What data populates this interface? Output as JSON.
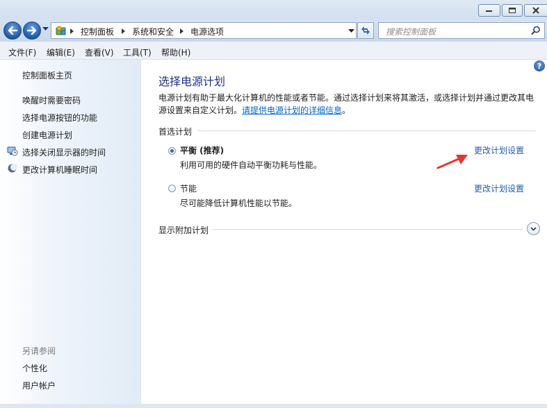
{
  "window": {
    "controls": {
      "minimize_icon": "minimize-icon",
      "maximize_icon": "maximize-icon",
      "close_icon": "close-icon"
    }
  },
  "address_bar": {
    "breadcrumbs": [
      "控制面板",
      "系统和安全",
      "电源选项"
    ]
  },
  "search": {
    "placeholder": "搜索控制面板"
  },
  "menu": {
    "items": [
      "文件(F)",
      "编辑(E)",
      "查看(V)",
      "工具(T)",
      "帮助(H)"
    ]
  },
  "sidebar": {
    "home": "控制面板主页",
    "links": [
      "唤醒时需要密码",
      "选择电源按钮的功能",
      "创建电源计划",
      "选择关闭显示器的时间",
      "更改计算机睡眠时间"
    ],
    "see_also_title": "另请参阅",
    "see_also": [
      "个性化",
      "用户帐户"
    ]
  },
  "main": {
    "title": "选择电源计划",
    "description": "电源计划有助于最大化计算机的性能或者节能。通过选择计划来将其激活，或选择计划并通过更改其电源设置来自定义计划。",
    "description_link": "请提供电源计划的详细信息",
    "preferred_plans_label": "首选计划",
    "plans": [
      {
        "name": "平衡 (推荐)",
        "description": "利用可用的硬件自动平衡功耗与性能。",
        "link": "更改计划设置",
        "selected": true
      },
      {
        "name": "节能",
        "description": "尽可能降低计算机性能以节能。",
        "link": "更改计划设置",
        "selected": false
      }
    ],
    "additional_plans_label": "显示附加计划"
  },
  "colors": {
    "link": "#1f5cb8",
    "title": "#1e3287",
    "annotation_arrow": "#e8372a"
  }
}
